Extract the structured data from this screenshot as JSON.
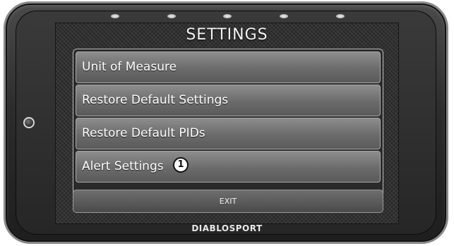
{
  "screen": {
    "title": "SETTINGS",
    "menu_items": [
      {
        "label": "Unit of Measure"
      },
      {
        "label": "Restore Default Settings"
      },
      {
        "label": "Restore Default PIDs"
      },
      {
        "label": "Alert Settings"
      }
    ],
    "callout": "1",
    "exit_label": "EXIT"
  },
  "device": {
    "brand": "DIABLOSPORT",
    "led_count": 5,
    "home_button_icon": "power-ring-icon"
  },
  "colors": {
    "bezel": "#2c2c2c",
    "menu_item": "#7a7a7a",
    "text": "#ffffff"
  }
}
